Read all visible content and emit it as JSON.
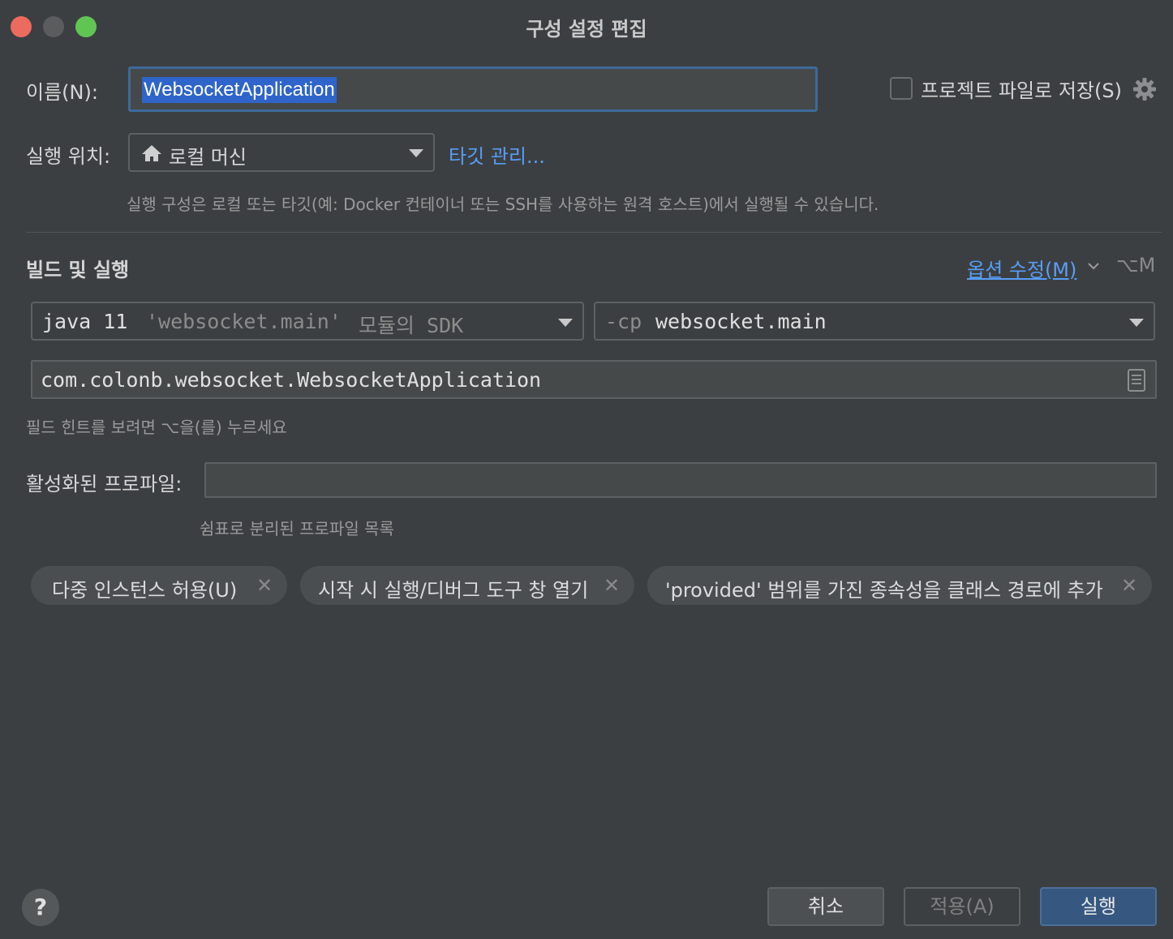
{
  "window": {
    "title": "구성 설정 편집"
  },
  "name": {
    "label": "이름(N):",
    "value": "WebsocketApplication"
  },
  "store_as_project_file": {
    "label": "프로젝트 파일로 저장(S)",
    "checked": false
  },
  "run_on": {
    "label": "실행 위치:",
    "selected": "로컬 머신",
    "icon": "home-icon",
    "manage_targets": "타깃 관리...",
    "hint": "실행 구성은 로컬 또는 타깃(예: Docker 컨테이너 또는 SSH를 사용하는 원격 호스트)에서 실행될 수 있습니다."
  },
  "build_run": {
    "title": "빌드 및 실행",
    "modify_options": "옵션 수정(M)",
    "shortcut": "⌥M",
    "jdk": {
      "main": "java 11",
      "module": "'websocket.main'",
      "suffix": "모듈의 SDK"
    },
    "classpath": {
      "prefix": "-cp",
      "value": "websocket.main"
    },
    "main_class": "com.colonb.websocket.WebsocketApplication",
    "field_hint": "필드 힌트를 보려면 ⌥을(를) 누르세요"
  },
  "active_profiles": {
    "label": "활성화된 프로파일:",
    "value": "",
    "hint": "쉼표로 분리된 프로파일 목록"
  },
  "option_chips": [
    {
      "label": "다중 인스턴스 허용(U)"
    },
    {
      "label": "시작 시 실행/디버그 도구 창 열기"
    },
    {
      "label": "'provided' 범위를 가진 종속성을 클래스 경로에 추가"
    }
  ],
  "buttons": {
    "help": "?",
    "cancel": "취소",
    "apply": "적용(A)",
    "run": "실행"
  },
  "colors": {
    "background": "#3c3f41",
    "accent": "#589df6",
    "primary_button": "#365880",
    "selection": "#2f65ca"
  }
}
